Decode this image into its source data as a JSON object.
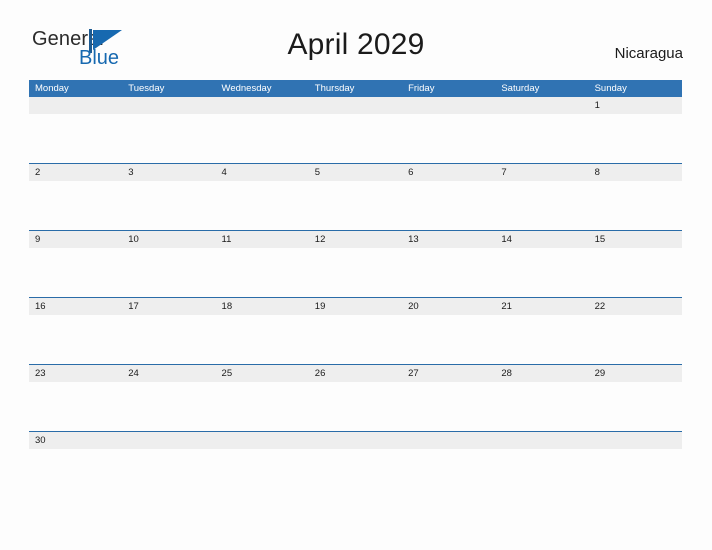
{
  "brand": {
    "name_part1": "General",
    "name_part2": "Blue",
    "mark": "triangle-logo",
    "color_dark": "#2b2b2b",
    "color_blue": "#1769b0"
  },
  "header": {
    "title": "April 2029",
    "country": "Nicaragua"
  },
  "calendar": {
    "accent_color": "#3073b3",
    "band_color": "#eeeeee",
    "rule_color": "#2a6ca8",
    "weekdays": [
      "Monday",
      "Tuesday",
      "Wednesday",
      "Thursday",
      "Friday",
      "Saturday",
      "Sunday"
    ],
    "weeks": [
      [
        "",
        "",
        "",
        "",
        "",
        "",
        "1"
      ],
      [
        "2",
        "3",
        "4",
        "5",
        "6",
        "7",
        "8"
      ],
      [
        "9",
        "10",
        "11",
        "12",
        "13",
        "14",
        "15"
      ],
      [
        "16",
        "17",
        "18",
        "19",
        "20",
        "21",
        "22"
      ],
      [
        "23",
        "24",
        "25",
        "26",
        "27",
        "28",
        "29"
      ],
      [
        "30",
        "",
        "",
        "",
        "",
        "",
        ""
      ]
    ]
  }
}
